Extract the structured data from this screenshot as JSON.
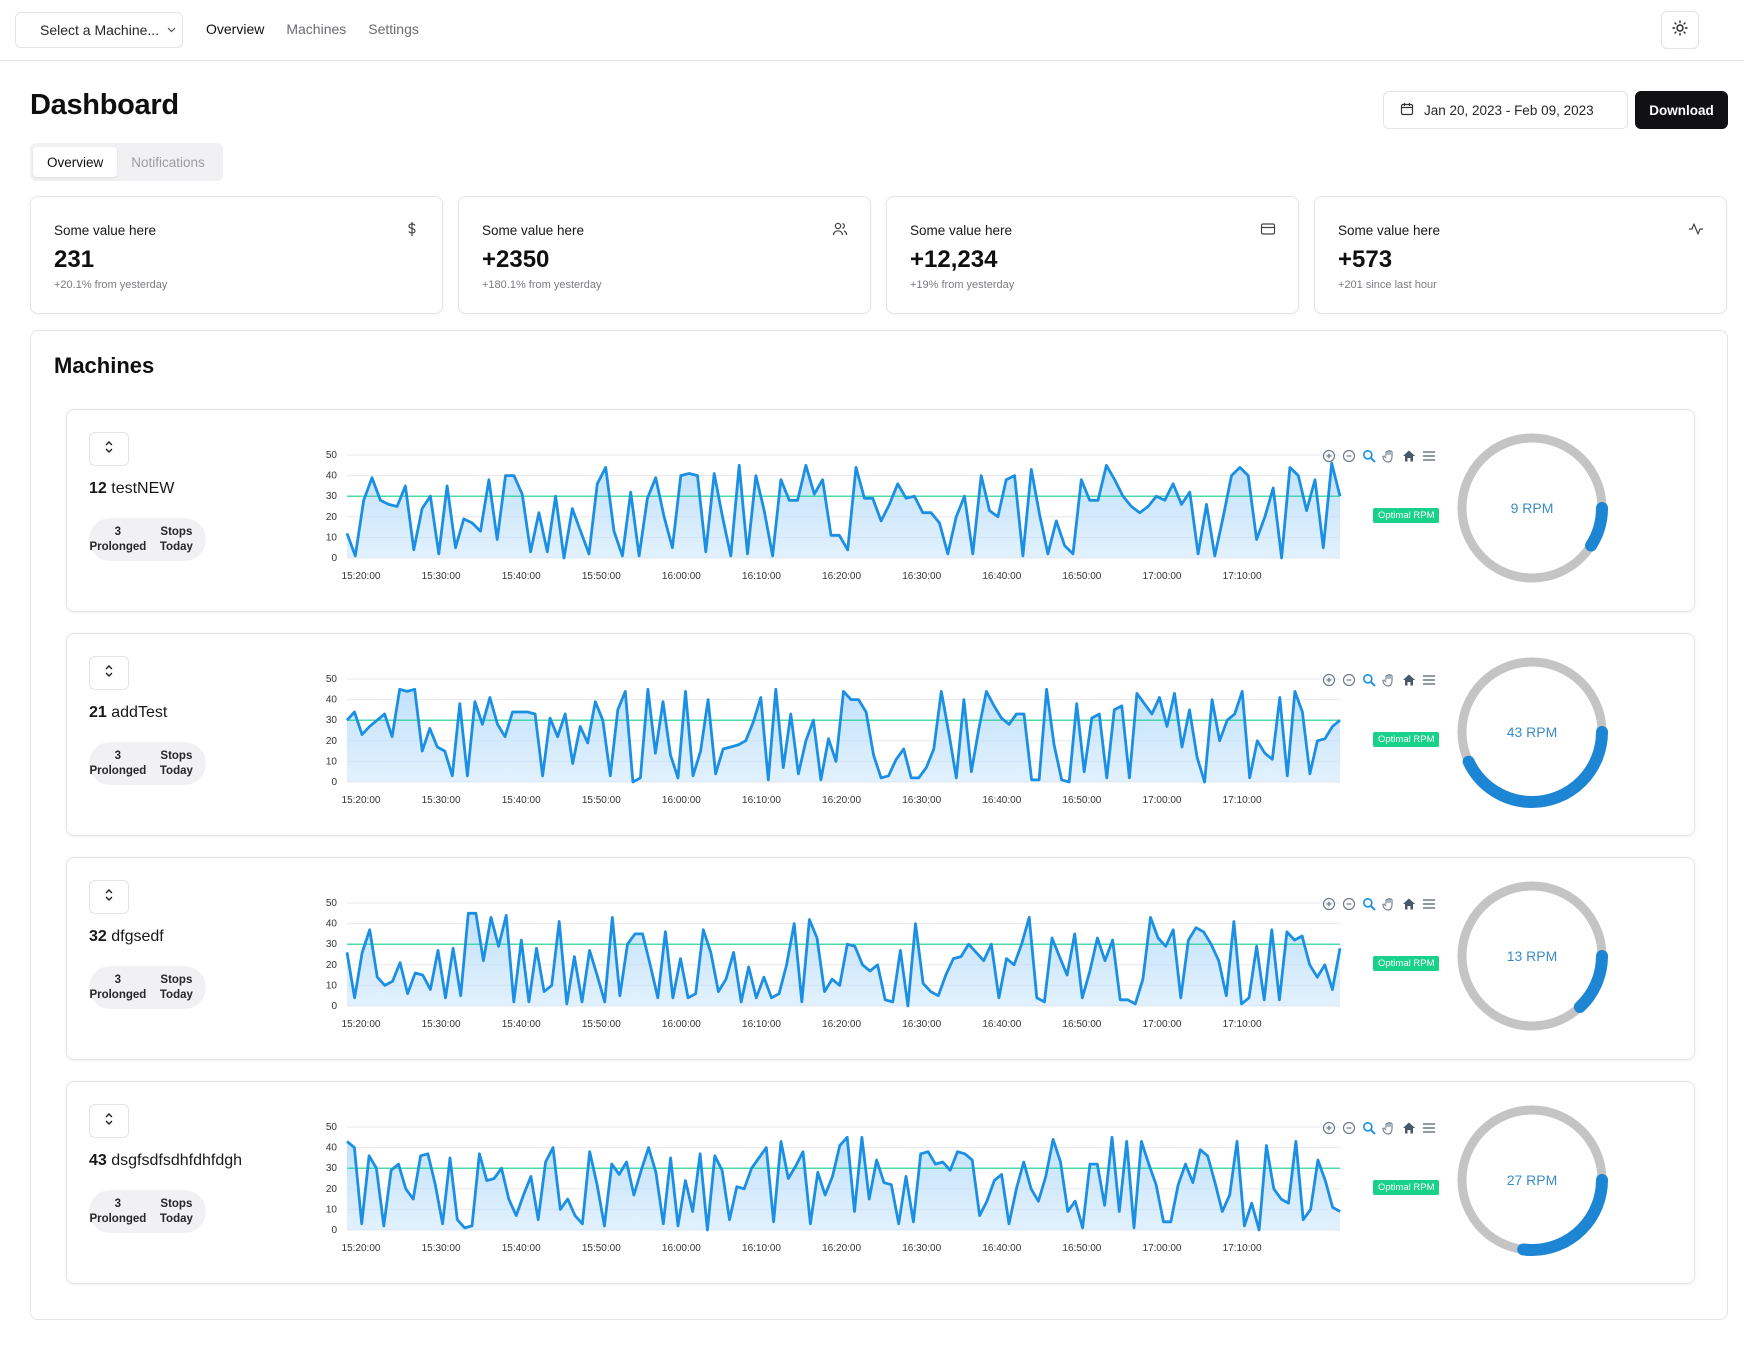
{
  "topbar": {
    "machine_select": "Select a Machine...",
    "nav": [
      "Overview",
      "Machines",
      "Settings"
    ],
    "active_nav": 0
  },
  "header": {
    "title": "Dashboard",
    "date_range": "Jan 20, 2023 - Feb 09, 2023",
    "download_label": "Download"
  },
  "tabs": [
    {
      "label": "Overview",
      "active": true
    },
    {
      "label": "Notifications",
      "active": false
    }
  ],
  "stats": [
    {
      "label": "Some value here",
      "value": "231",
      "sub": "+20.1% from yesterday",
      "icon": "dollar-icon"
    },
    {
      "label": "Some value here",
      "value": "+2350",
      "sub": "+180.1% from yesterday",
      "icon": "users-icon"
    },
    {
      "label": "Some value here",
      "value": "+12,234",
      "sub": "+19% from yesterday",
      "icon": "credit-card-icon"
    },
    {
      "label": "Some value here",
      "value": "+573",
      "sub": "+201 since last hour",
      "icon": "activity-icon"
    }
  ],
  "machines_section": {
    "title": "Machines",
    "optimal_label": "Optimal RPM",
    "x_ticks": [
      "15:20:00",
      "15:30:00",
      "15:40:00",
      "15:50:00",
      "16:00:00",
      "16:10:00",
      "16:20:00",
      "16:30:00",
      "16:40:00",
      "16:50:00",
      "17:00:00",
      "17:10:00"
    ],
    "y_ticks": [
      "50",
      "40",
      "30",
      "20",
      "10",
      "0"
    ],
    "y_max": 50,
    "optimal_rpm": 30,
    "gauge_max_rpm": 100,
    "colors": {
      "line": "#1a8fe3",
      "fill": "#bfe0fb",
      "optimal": "#1ad18a",
      "gauge": "#1c86d4",
      "gauge_track": "#c4c4c4"
    },
    "machines": [
      {
        "id": "12",
        "name": "testNEW",
        "stops_line1": "3 Prolonged",
        "stops_line2": "Stops Today",
        "rpm": 9,
        "rpm_label": "9 RPM",
        "series": [
          12,
          1,
          28,
          39,
          28,
          26,
          25,
          35,
          4,
          24,
          30,
          2,
          35,
          5,
          19,
          17,
          13,
          38,
          9,
          40,
          40,
          31,
          3,
          22,
          3,
          30,
          0,
          24,
          13,
          2,
          36,
          44,
          13,
          1,
          32,
          1,
          29,
          39,
          20,
          5,
          40,
          41,
          40,
          3,
          41,
          20,
          1,
          45,
          2,
          40,
          23,
          1,
          38,
          28,
          28,
          45,
          31,
          38,
          11,
          11,
          4,
          44,
          29,
          29,
          18,
          26,
          36,
          29,
          30,
          22,
          22,
          17,
          2,
          20,
          30,
          2,
          40,
          23,
          20,
          38,
          40,
          1,
          43,
          21,
          2,
          18,
          6,
          2,
          38,
          28,
          28,
          45,
          38,
          30,
          25,
          22,
          25,
          30,
          28,
          36,
          26,
          32,
          2,
          26,
          1,
          20,
          40,
          44,
          40,
          9,
          20,
          34,
          0,
          44,
          40,
          23,
          38,
          5,
          46,
          30
        ],
        "gauge_start": 1,
        "gauge_end": 1
      },
      {
        "id": "21",
        "name": "addTest",
        "stops_line1": "3 Prolonged",
        "stops_line2": "Stops Today",
        "rpm": 43,
        "rpm_label": "43 RPM",
        "series": [
          30,
          34,
          23,
          27,
          30,
          33,
          22,
          45,
          44,
          45,
          15,
          26,
          17,
          15,
          3,
          38,
          3,
          39,
          28,
          41,
          28,
          22,
          34,
          34,
          34,
          33,
          3,
          31,
          22,
          33,
          9,
          27,
          19,
          39,
          30,
          3,
          35,
          44,
          0,
          2,
          45,
          14,
          39,
          13,
          2,
          44,
          3,
          15,
          40,
          4,
          16,
          17,
          18,
          20,
          29,
          41,
          1,
          45,
          7,
          33,
          4,
          20,
          30,
          1,
          21,
          10,
          44,
          40,
          40,
          34,
          13,
          2,
          3,
          11,
          16,
          2,
          2,
          7,
          16,
          44,
          24,
          2,
          40,
          5,
          26,
          44,
          37,
          31,
          28,
          33,
          33,
          1,
          1,
          45,
          18,
          1,
          0,
          38,
          5,
          31,
          33,
          2,
          35,
          37,
          2,
          43,
          38,
          33,
          41,
          27,
          43,
          17,
          35,
          12,
          0,
          40,
          20,
          30,
          33,
          44,
          2,
          20,
          14,
          11,
          41,
          3,
          44,
          34,
          4,
          20,
          21,
          27,
          30
        ],
        "gauge_start": 1,
        "gauge_end": 1
      },
      {
        "id": "32",
        "name": "dfgsedf",
        "stops_line1": "3 Prolonged",
        "stops_line2": "Stops Today",
        "rpm": 13,
        "rpm_label": "13 RPM",
        "series": [
          26,
          4,
          26,
          37,
          14,
          10,
          12,
          21,
          6,
          16,
          15,
          8,
          27,
          4,
          28,
          5,
          45,
          45,
          22,
          43,
          29,
          44,
          2,
          32,
          2,
          28,
          7,
          10,
          41,
          1,
          24,
          2,
          27,
          15,
          2,
          43,
          5,
          30,
          35,
          35,
          20,
          4,
          36,
          4,
          23,
          4,
          6,
          37,
          26,
          7,
          13,
          26,
          2,
          19,
          4,
          14,
          4,
          6,
          20,
          40,
          2,
          42,
          33,
          7,
          13,
          10,
          30,
          29,
          20,
          17,
          20,
          3,
          2,
          27,
          0,
          40,
          11,
          7,
          5,
          15,
          23,
          24,
          30,
          26,
          22,
          30,
          4,
          23,
          20,
          30,
          43,
          4,
          2,
          33,
          24,
          15,
          35,
          4,
          17,
          33,
          22,
          32,
          3,
          3,
          1,
          13,
          43,
          33,
          29,
          37,
          4,
          32,
          38,
          36,
          30,
          22,
          5,
          41,
          1,
          4,
          29,
          3,
          37,
          3,
          36,
          32,
          34,
          20,
          14,
          20,
          8,
          28
        ],
        "gauge_start": 1,
        "gauge_end": 1
      },
      {
        "id": "43",
        "name": "dsgfsdfsdhfdhfdgh",
        "stops_line1": "3 Prolonged",
        "stops_line2": "Stops Today",
        "rpm": 27,
        "rpm_label": "27 RPM",
        "series": [
          43,
          40,
          3,
          36,
          30,
          2,
          29,
          32,
          20,
          15,
          36,
          37,
          22,
          3,
          35,
          5,
          1,
          2,
          37,
          24,
          25,
          30,
          15,
          7,
          17,
          26,
          5,
          33,
          40,
          10,
          15,
          7,
          3,
          38,
          22,
          2,
          32,
          27,
          33,
          17,
          29,
          40,
          28,
          3,
          35,
          2,
          24,
          9,
          37,
          0,
          36,
          29,
          5,
          21,
          20,
          30,
          35,
          40,
          4,
          43,
          25,
          31,
          38,
          3,
          28,
          17,
          26,
          41,
          45,
          9,
          45,
          15,
          34,
          23,
          22,
          3,
          26,
          4,
          37,
          38,
          32,
          33,
          29,
          38,
          37,
          34,
          7,
          14,
          24,
          27,
          3,
          20,
          33,
          20,
          14,
          26,
          44,
          33,
          9,
          14,
          1,
          32,
          32,
          12,
          45,
          9,
          43,
          1,
          43,
          32,
          22,
          4,
          4,
          22,
          32,
          23,
          39,
          36,
          23,
          9,
          17,
          43,
          2,
          13,
          0,
          41,
          20,
          15,
          13,
          43,
          5,
          10,
          34,
          24,
          11,
          9
        ],
        "gauge_start": 1,
        "gauge_end": 1
      }
    ]
  }
}
